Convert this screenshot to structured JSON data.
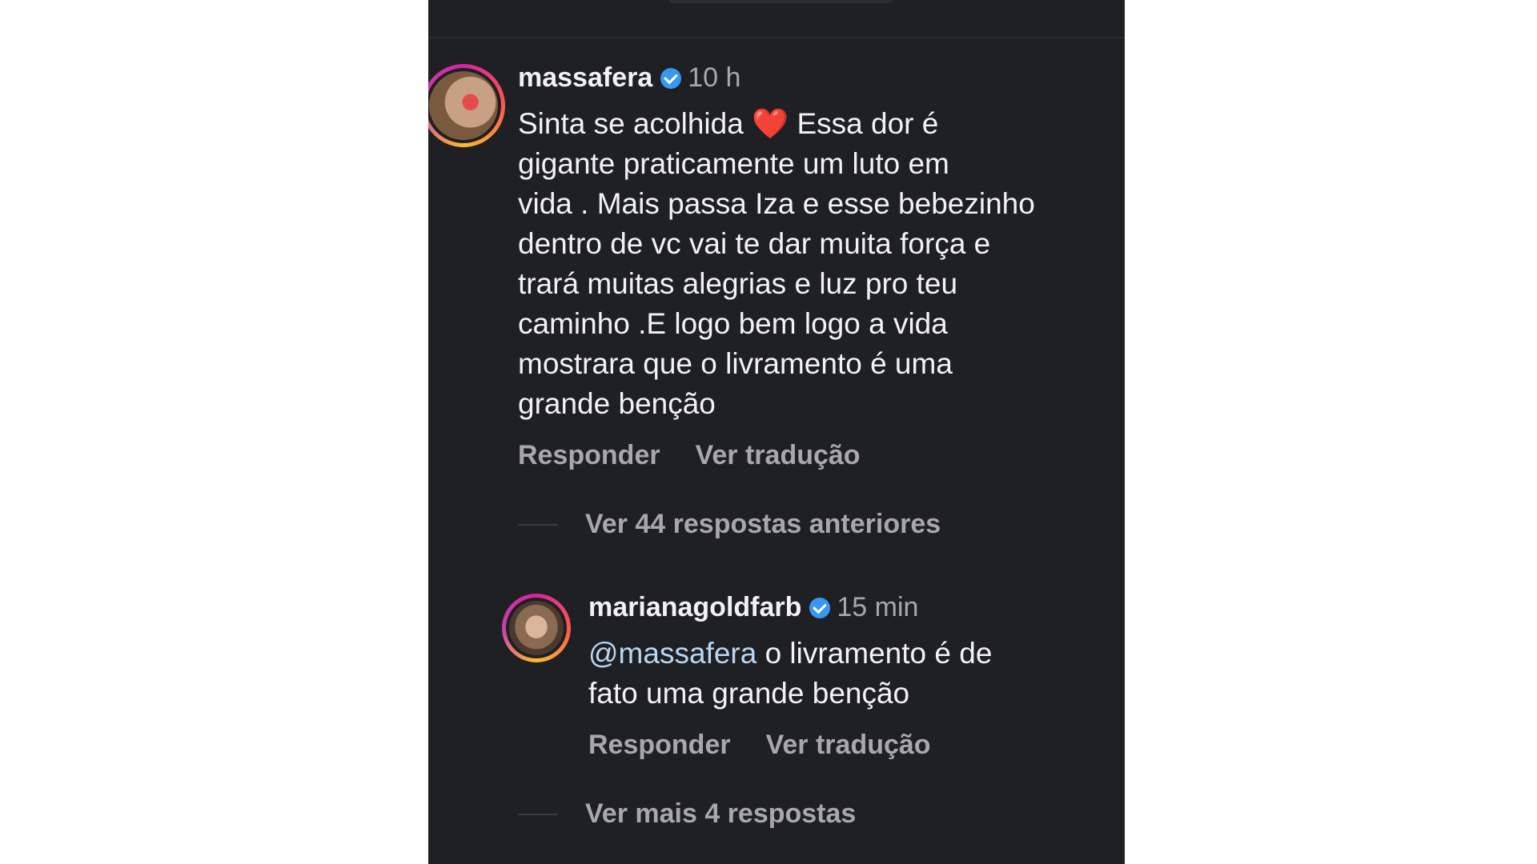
{
  "comments": [
    {
      "username": "massafera",
      "time": "10 h",
      "text_part1": "Sinta se acolhida ",
      "heart": "❤️",
      "text_part2": "  Essa dor é\ngigante praticamente um luto em\nvida . Mais passa Iza e esse bebezinho\ndentro de vc vai te dar muita força  e\ntrará muitas alegrias e luz pro teu\ncaminho .E logo bem logo a vida\nmostrara que o livramento é uma\ngrande benção",
      "reply_label": "Responder",
      "translate_label": "Ver tradução"
    }
  ],
  "view_previous_replies": "Ver 44 respostas anteriores",
  "reply": {
    "username": "marianagoldfarb",
    "time": "15 min",
    "mention": "@massafera",
    "text": " o livramento é de\nfato uma grande benção",
    "reply_label": "Responder",
    "translate_label": "Ver tradução"
  },
  "view_more_replies": "Ver mais 4 respostas",
  "colors": {
    "background": "#1f2023",
    "text": "#f2f2f2",
    "muted": "#a8a8a8",
    "verified": "#3897f0",
    "mention": "#b9d6f2"
  }
}
